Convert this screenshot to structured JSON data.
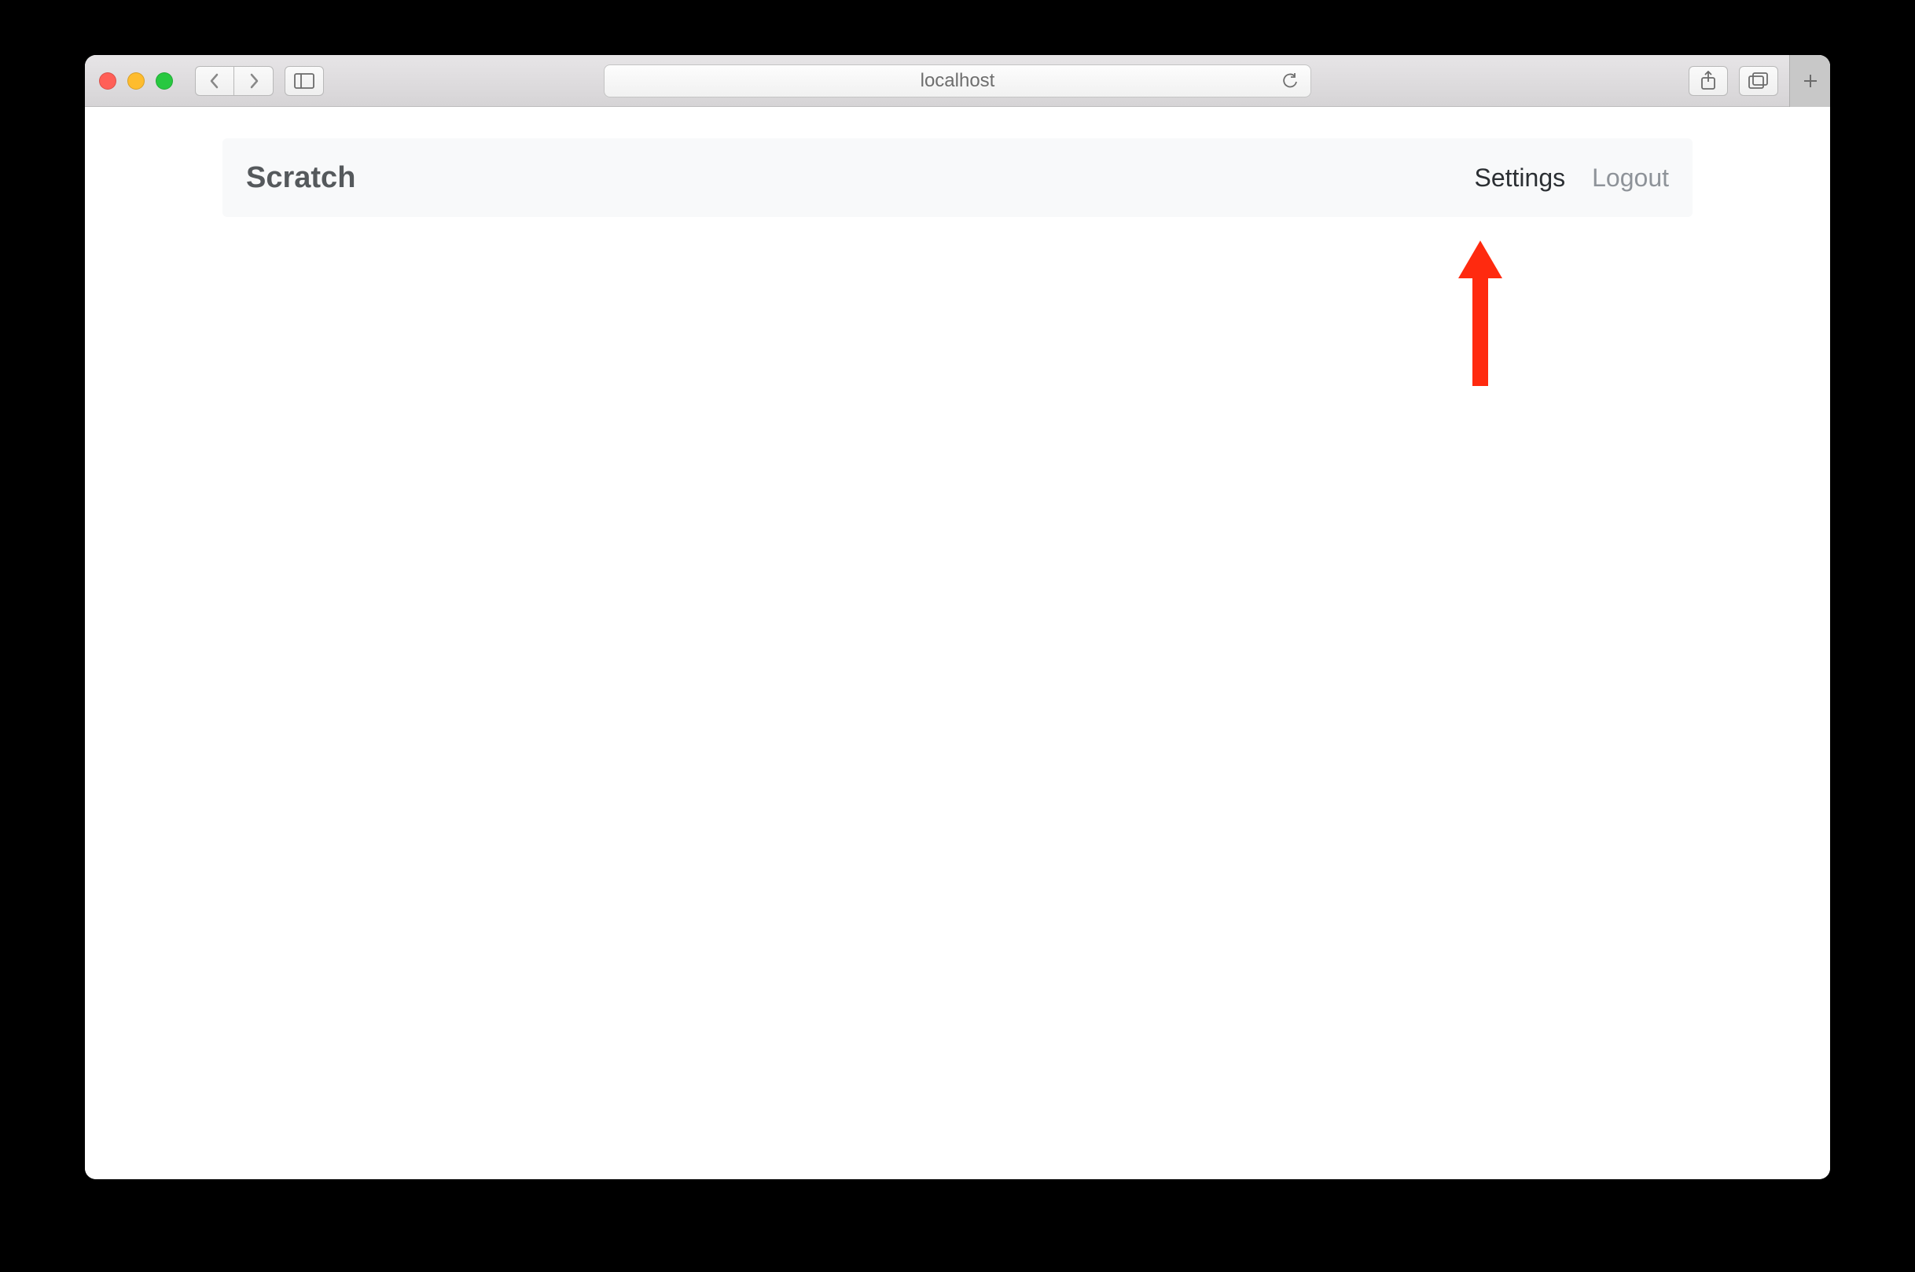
{
  "browser": {
    "address": "localhost"
  },
  "navbar": {
    "brand": "Scratch",
    "links": [
      {
        "label": "Settings",
        "active": true
      },
      {
        "label": "Logout",
        "active": false
      }
    ]
  },
  "annotation": {
    "type": "arrow",
    "color": "#ff2a0f",
    "target": "settings-link"
  }
}
